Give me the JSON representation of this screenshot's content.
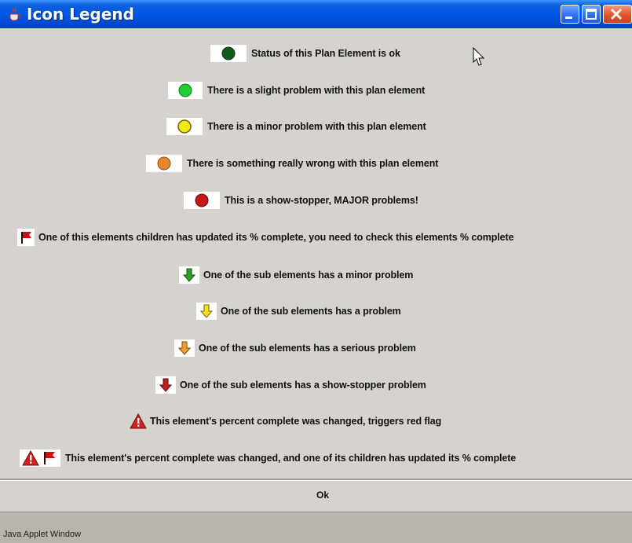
{
  "window": {
    "title": "Icon Legend",
    "buttons": [
      "minimize",
      "maximize",
      "close"
    ]
  },
  "legend": [
    {
      "icon": "circle-dark-green",
      "color": "#0f5a1f",
      "label": "Status of this Plan Element is ok"
    },
    {
      "icon": "circle-light-green",
      "color": "#22cc33",
      "label": "There is a slight problem with this plan element"
    },
    {
      "icon": "circle-yellow",
      "color": "#f2ea18",
      "label": "There is a minor problem with this plan element"
    },
    {
      "icon": "circle-orange",
      "color": "#e6892e",
      "label": "There is something really wrong with this plan element"
    },
    {
      "icon": "circle-red",
      "color": "#c01a1a",
      "label": "This is a show-stopper, MAJOR problems!"
    },
    {
      "icon": "red-flag-icon",
      "color": "#d01010",
      "label": "One of this elements children has updated its % complete, you need to check this elements % complete"
    },
    {
      "icon": "green-down-arrow-icon",
      "color": "#2ca02c",
      "label": "One of the sub elements has a minor problem"
    },
    {
      "icon": "yellow-down-arrow-icon",
      "color": "#f0e020",
      "label": "One of the sub elements has a problem"
    },
    {
      "icon": "orange-down-arrow-icon",
      "color": "#f0a030",
      "label": "One of the sub elements has a serious problem"
    },
    {
      "icon": "red-down-arrow-icon",
      "color": "#c02020",
      "label": "One of the sub elements has a show-stopper problem"
    },
    {
      "icon": "warning-triangle-icon",
      "color": "#d02020",
      "label": "This element's percent complete was changed, triggers red flag"
    },
    {
      "icon": "warning-triangle-and-flag-icon",
      "color": "#d02020",
      "label": "This element's percent complete was changed, and one of its children has updated its % complete"
    }
  ],
  "ok_button": "Ok",
  "status_bar": "Java Applet Window"
}
